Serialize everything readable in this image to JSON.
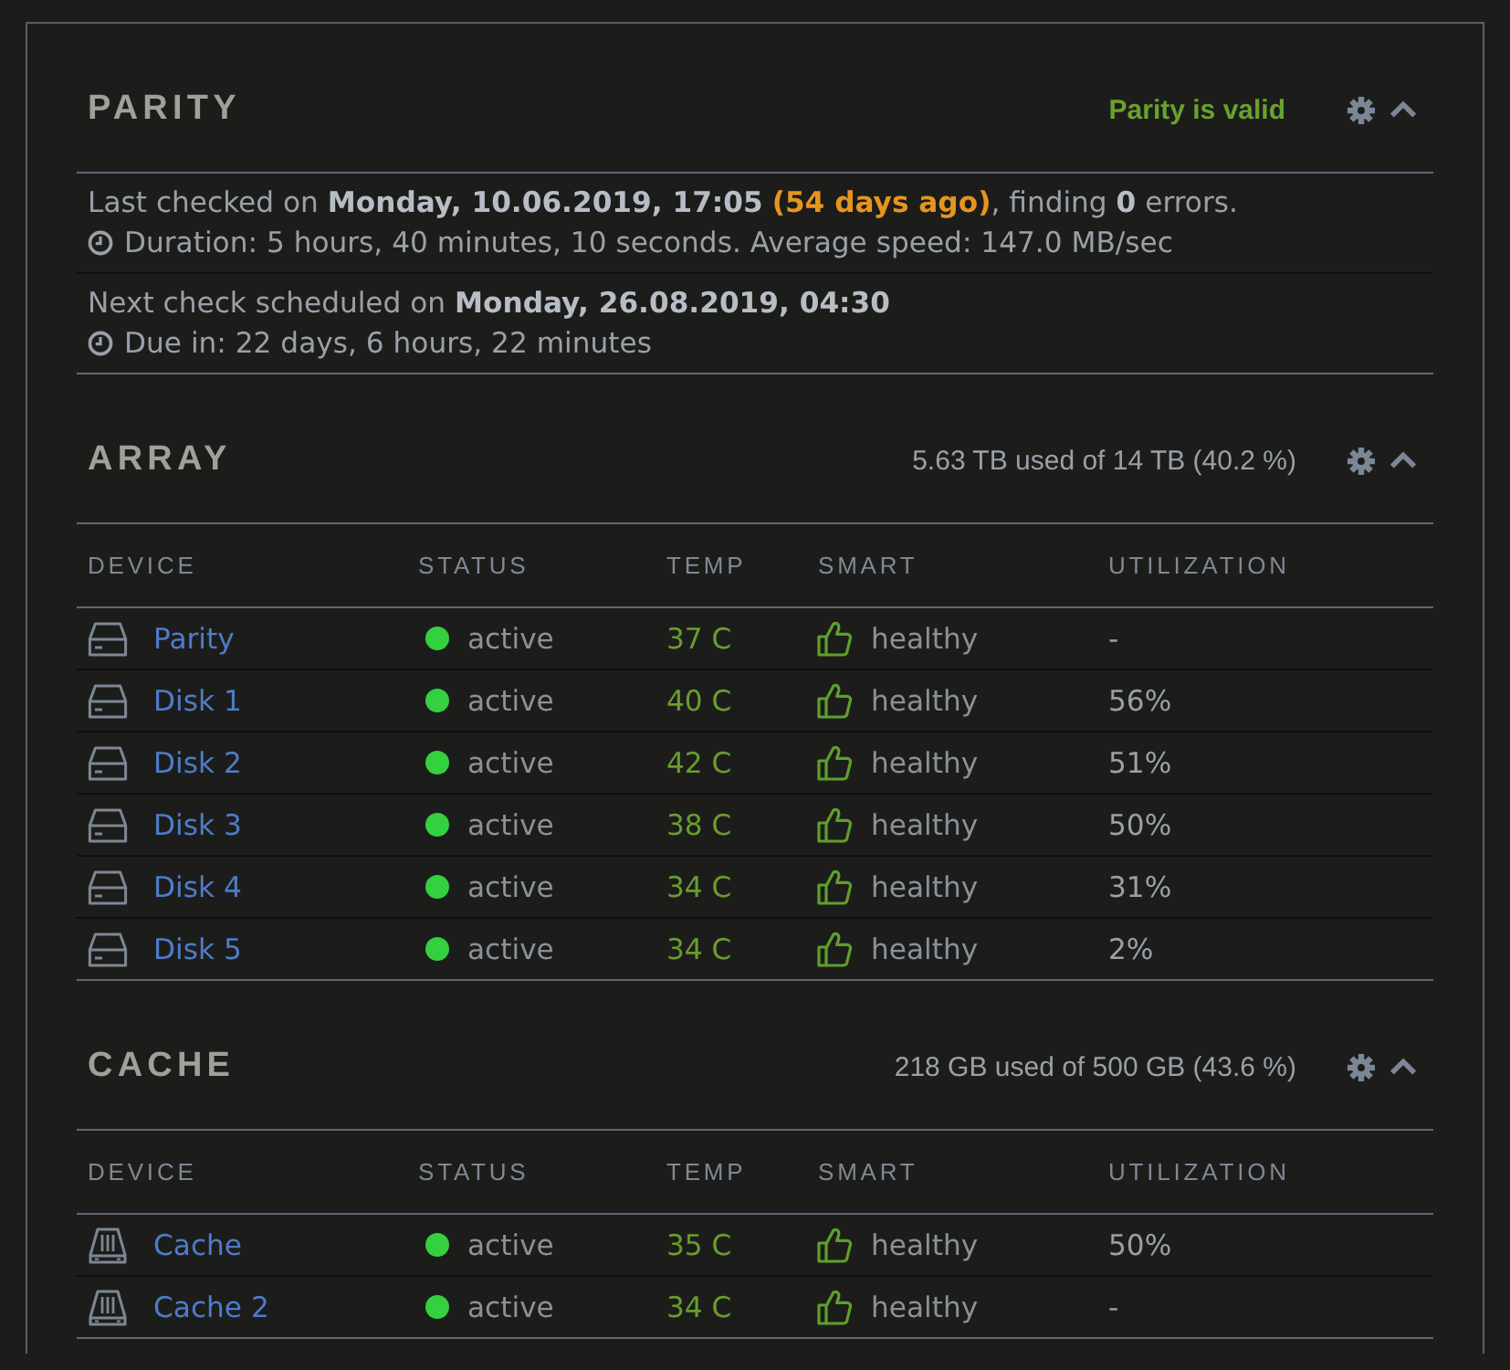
{
  "sections": [
    {
      "kind": "parity",
      "title": "PARITY",
      "summary": "Parity is valid",
      "entries": [
        {
          "segments": [
            {
              "text": "Last checked on **Monday, 10.06.2019, 17:05** ",
              "highlight": false
            },
            {
              "text": "(54 days ago)",
              "highlight": true
            },
            {
              "text": ", finding **0** errors.",
              "highlight": false
            }
          ],
          "detail": "Duration: 5 hours, 40 minutes, 10 seconds. Average speed: 147.0 MB/sec"
        },
        {
          "segments": [
            {
              "text": "Next check scheduled on **Monday, 26.08.2019, 04:30**",
              "highlight": false
            }
          ],
          "detail": "Due in: 22 days, 6 hours, 22 minutes"
        }
      ]
    },
    {
      "kind": "array",
      "title": "ARRAY",
      "summary": "5.63 TB used of 14 TB (40.2 %)",
      "columns": [
        "DEVICE",
        "STATUS",
        "TEMP",
        "SMART",
        "UTILIZATION"
      ],
      "rows": [
        {
          "device": "Parity",
          "status": "active",
          "color": "#35d03f",
          "temp": "37 C",
          "smart": "healthy",
          "utilization": "-"
        },
        {
          "device": "Disk 1",
          "status": "active",
          "color": "#35d03f",
          "temp": "40 C",
          "smart": "healthy",
          "utilization": "56%"
        },
        {
          "device": "Disk 2",
          "status": "active",
          "color": "#35d03f",
          "temp": "42 C",
          "smart": "healthy",
          "utilization": "51%"
        },
        {
          "device": "Disk 3",
          "status": "active",
          "color": "#35d03f",
          "temp": "38 C",
          "smart": "healthy",
          "utilization": "50%"
        },
        {
          "device": "Disk 4",
          "status": "active",
          "color": "#35d03f",
          "temp": "34 C",
          "smart": "healthy",
          "utilization": "31%"
        },
        {
          "device": "Disk 5",
          "status": "active",
          "color": "#35d03f",
          "temp": "34 C",
          "smart": "healthy",
          "utilization": "2%"
        }
      ]
    },
    {
      "kind": "cache",
      "title": "CACHE",
      "summary": "218 GB used of 500 GB (43.6 %)",
      "columns": [
        "DEVICE",
        "STATUS",
        "TEMP",
        "SMART",
        "UTILIZATION"
      ],
      "rows": [
        {
          "device": "Cache",
          "status": "active",
          "color": "#35d03f",
          "temp": "35 C",
          "smart": "healthy",
          "utilization": "50%"
        },
        {
          "device": "Cache 2",
          "status": "active",
          "color": "#35d03f",
          "temp": "34 C",
          "smart": "healthy",
          "utilization": "-"
        }
      ]
    }
  ]
}
